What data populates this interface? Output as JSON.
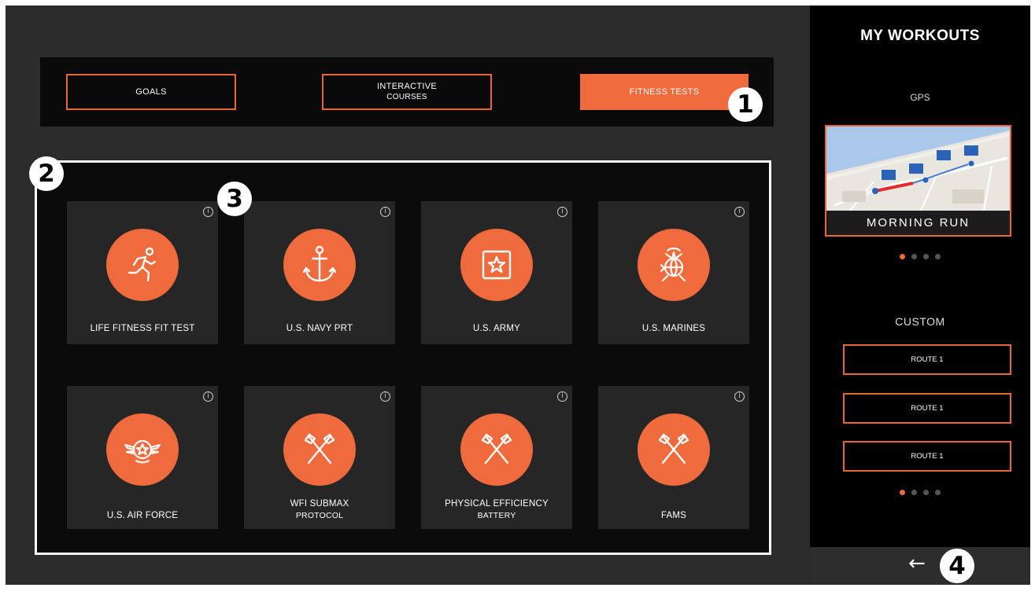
{
  "tabs": [
    {
      "line1": "GOALS",
      "line2": ""
    },
    {
      "line1": "INTERACTIVE",
      "line2": "COURSES"
    },
    {
      "line1": "FITNESS TESTS",
      "line2": ""
    }
  ],
  "active_tab": "FITNESS TESTS",
  "cards": [
    {
      "line1": "LIFE FITNESS FIT TEST",
      "line2": "",
      "icon": "running-person-icon"
    },
    {
      "line1": "U.S. NAVY PRT",
      "line2": "",
      "icon": "anchor-icon"
    },
    {
      "line1": "U.S. ARMY",
      "line2": "",
      "icon": "army-star-icon"
    },
    {
      "line1": "U.S. MARINES",
      "line2": "",
      "icon": "marines-emblem-icon"
    },
    {
      "line1": "U.S. AIR FORCE",
      "line2": "",
      "icon": "air-force-wings-icon"
    },
    {
      "line1": "WFI SUBMAX",
      "line2": "PROTOCOL",
      "icon": "crossed-axes-icon"
    },
    {
      "line1": "PHYSICAL EFFICIENCY",
      "line2": "BATTERY",
      "icon": "crossed-axes-icon"
    },
    {
      "line1": "FAMS",
      "line2": "",
      "icon": "crossed-axes-icon"
    }
  ],
  "info_glyph": "i",
  "markers": [
    "1",
    "2",
    "3",
    "4"
  ],
  "sidebar": {
    "title": "MY WORKOUTS",
    "gps_label": "GPS",
    "featured_workout": "MORNING RUN",
    "custom_label": "CUSTOM",
    "routes": [
      "ROUTE 1",
      "ROUTE 1",
      "ROUTE 1"
    ],
    "gps_carousel_active": 1,
    "gps_carousel_total": 4,
    "custom_carousel_active": 1,
    "custom_carousel_total": 4
  },
  "back_arrow": "←",
  "colors": {
    "accent": "#ef6a3c",
    "screen_bg": "#2c2c2c",
    "panel_bg": "#0b0b0b",
    "card_bg": "#262626",
    "sidebar_bg": "#000000"
  }
}
